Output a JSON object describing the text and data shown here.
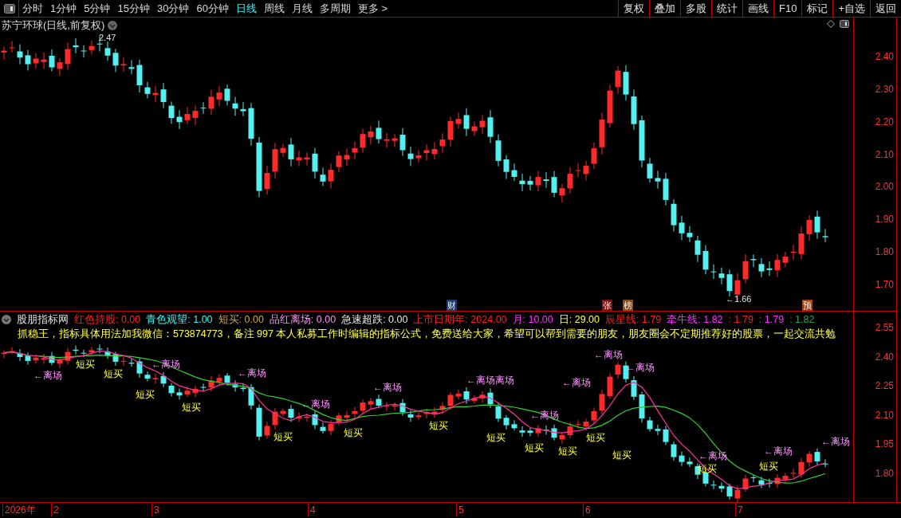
{
  "toolbar": {
    "periods": [
      {
        "label": "分时",
        "selected": false
      },
      {
        "label": "1分钟",
        "selected": false
      },
      {
        "label": "5分钟",
        "selected": false
      },
      {
        "label": "15分钟",
        "selected": false
      },
      {
        "label": "30分钟",
        "selected": false
      },
      {
        "label": "60分钟",
        "selected": false
      },
      {
        "label": "日线",
        "selected": true
      },
      {
        "label": "周线",
        "selected": false
      },
      {
        "label": "月线",
        "selected": false
      },
      {
        "label": "多周期",
        "selected": false
      },
      {
        "label": "更多 >",
        "selected": false
      }
    ],
    "buttons": [
      "复权",
      "叠加",
      "多股",
      "统计",
      "画线",
      "F10",
      "标记",
      "+自选",
      "返回"
    ]
  },
  "main_chart": {
    "title": "苏宁环球(日线,前复权)",
    "high_marker": "2.47",
    "low_marker": "←1.66",
    "events": [
      {
        "text": "财",
        "color": "#1e3a6e"
      },
      {
        "text": "张",
        "color": "#7a1010"
      },
      {
        "text": "榜",
        "color": "#8a4a10"
      },
      {
        "text": "预",
        "color": "#a04010"
      }
    ],
    "price_ticks": [
      "2.40",
      "2.30",
      "2.20",
      "2.10",
      "2.00",
      "1.90",
      "1.80",
      "1.70"
    ]
  },
  "indicator": {
    "name": "股朋指标网",
    "values": [
      {
        "text": "红色持股: 0.00",
        "color": "#ff2020"
      },
      {
        "text": "青色观望: 1.00",
        "color": "#40f0f0"
      },
      {
        "text": "短买: 0.00",
        "color": "#d4a840"
      },
      {
        "text": "品红离场: 0.00",
        "color": "#ff90ff"
      },
      {
        "text": "急速超跌: 0.00",
        "color": "#e8e8e8"
      },
      {
        "text": "上市日期年: 2024.00",
        "color": "#ff2020"
      },
      {
        "text": "月: 10.00",
        "color": "#ff30ff"
      },
      {
        "text": "日: 29.00",
        "color": "#ffff40"
      },
      {
        "text": "辰星线: 1.79",
        "color": "#ff2020"
      },
      {
        "text": "牵牛线: 1.82",
        "color": "#ff30ff"
      },
      {
        "text": ": 1.79",
        "color": "#ff2020"
      },
      {
        "text": ": 1.79",
        "color": "#ff30ff"
      },
      {
        "text": ": 1.82",
        "color": "#30a060"
      }
    ],
    "note": "抓稳王，指标具体用法加我微信：573874773，备注 997 本人私募工作时编辑的指标公式，免费送给大家，希望可以帮到需要的朋友，朋友圈会不定期推荐好的股票，一起交流共勉",
    "signals": [
      {
        "kind": "exit",
        "text": "←离场"
      },
      {
        "kind": "exit",
        "text": "←离场"
      },
      {
        "kind": "exit",
        "text": "←离场"
      },
      {
        "kind": "exit",
        "text": "←离场"
      },
      {
        "kind": "exit",
        "text": "←离场"
      },
      {
        "kind": "exit",
        "text": "←离场离场"
      },
      {
        "kind": "exit",
        "text": "←离场"
      },
      {
        "kind": "exit",
        "text": "←离场"
      },
      {
        "kind": "exit",
        "text": "←离场"
      },
      {
        "kind": "exit",
        "text": "←离场"
      },
      {
        "kind": "exit",
        "text": "←离场"
      },
      {
        "kind": "exit",
        "text": "←离场"
      },
      {
        "kind": "exit",
        "text": "←离场"
      },
      {
        "kind": "buy",
        "text": "短买"
      },
      {
        "kind": "buy",
        "text": "短买"
      },
      {
        "kind": "buy",
        "text": "短买"
      },
      {
        "kind": "buy",
        "text": "短买"
      },
      {
        "kind": "buy",
        "text": "短买"
      },
      {
        "kind": "buy",
        "text": "短买"
      },
      {
        "kind": "buy",
        "text": "短买"
      },
      {
        "kind": "buy",
        "text": "短买"
      },
      {
        "kind": "buy",
        "text": "短买"
      },
      {
        "kind": "buy",
        "text": "短买"
      },
      {
        "kind": "buy",
        "text": "短买"
      },
      {
        "kind": "buy",
        "text": "短买"
      },
      {
        "kind": "buy",
        "text": "短买"
      },
      {
        "kind": "buy",
        "text": "短买"
      }
    ],
    "price_ticks": [
      "2.55",
      "2.40",
      "2.25",
      "2.10",
      "1.95",
      "1.80"
    ]
  },
  "date_axis": [
    "2026年",
    "2",
    "3",
    "4",
    "5",
    "6",
    "7"
  ]
}
